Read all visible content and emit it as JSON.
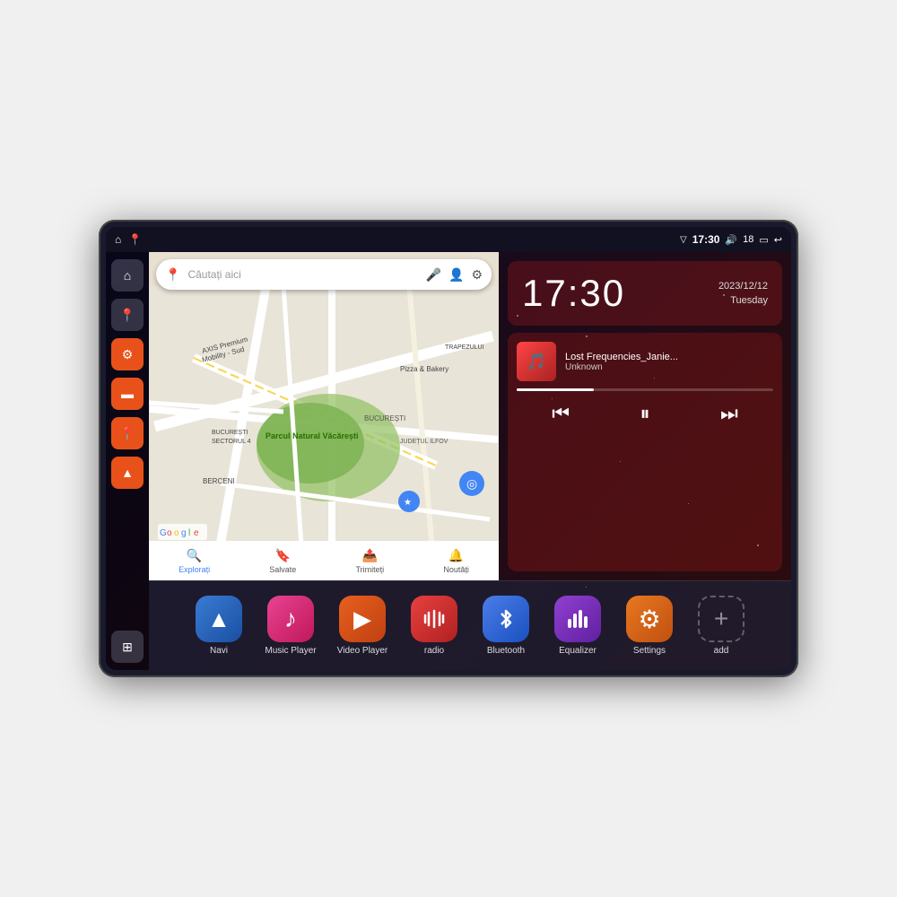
{
  "device": {
    "status_bar": {
      "wifi_icon": "▼",
      "time": "17:30",
      "volume_icon": "🔊",
      "battery_level": "18",
      "battery_icon": "🔋",
      "back_icon": "↩"
    },
    "sidebar": {
      "items": [
        {
          "id": "home",
          "icon": "⌂",
          "style": "dark"
        },
        {
          "id": "maps",
          "icon": "📍",
          "style": "dark"
        },
        {
          "id": "settings",
          "icon": "⚙",
          "style": "orange"
        },
        {
          "id": "files",
          "icon": "📁",
          "style": "orange"
        },
        {
          "id": "location",
          "icon": "📍",
          "style": "orange"
        },
        {
          "id": "nav",
          "icon": "▲",
          "style": "orange"
        }
      ],
      "grid_icon": "⊞"
    },
    "map": {
      "search_placeholder": "Căutați aici",
      "bottom_tabs": [
        {
          "label": "Explorați",
          "icon": "🔍",
          "active": true
        },
        {
          "label": "Salvate",
          "icon": "🔖",
          "active": false
        },
        {
          "label": "Trimiteți",
          "icon": "📤",
          "active": false
        },
        {
          "label": "Noutăți",
          "icon": "🔔",
          "active": false
        }
      ],
      "locations": [
        "AXIS Premium Mobility - Sud",
        "Pizza & Bakery",
        "Parcul Natural Văcărești",
        "BUCUREȘTI",
        "JUDEȚUL ILFOV",
        "BERCENI",
        "BUCUREȘTI SECTORUL 4",
        "TRAPEZULUI"
      ]
    },
    "clock": {
      "time": "17:30",
      "date": "2023/12/12",
      "day": "Tuesday"
    },
    "music": {
      "title": "Lost Frequencies_Janie...",
      "artist": "Unknown",
      "controls": {
        "prev": "⏮",
        "play_pause": "⏸",
        "next": "⏭"
      }
    },
    "apps": [
      {
        "id": "navi",
        "label": "Navi",
        "icon": "▲",
        "style": "icon-navi"
      },
      {
        "id": "music-player",
        "label": "Music Player",
        "icon": "♪",
        "style": "icon-music"
      },
      {
        "id": "video-player",
        "label": "Video Player",
        "icon": "▶",
        "style": "icon-video"
      },
      {
        "id": "radio",
        "label": "radio",
        "icon": "📻",
        "style": "icon-radio"
      },
      {
        "id": "bluetooth",
        "label": "Bluetooth",
        "icon": "⚡",
        "style": "icon-bluetooth"
      },
      {
        "id": "equalizer",
        "label": "Equalizer",
        "icon": "🎚",
        "style": "icon-equalizer"
      },
      {
        "id": "settings",
        "label": "Settings",
        "icon": "⚙",
        "style": "icon-settings"
      },
      {
        "id": "add",
        "label": "add",
        "icon": "+",
        "style": "icon-add"
      }
    ]
  }
}
